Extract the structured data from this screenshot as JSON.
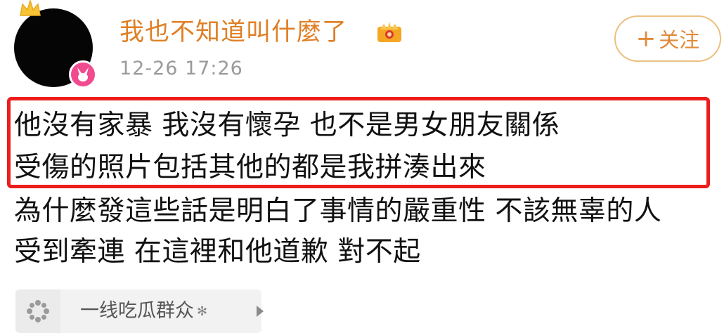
{
  "post": {
    "username": "我也不知道叫什麼了",
    "timestamp": "12-26 17:26",
    "follow_label": "关注",
    "highlighted_lines": [
      "他沒有家暴 我沒有懷孕 也不是男女朋友關係",
      "受傷的照片包括其他的都是我拼湊出來"
    ],
    "body_lines": [
      "為什麼發這些話是明白了事情的嚴重性 不該無辜的人",
      "受到牽連 在這裡和他道歉 對不起"
    ]
  },
  "topic": {
    "label": "一线吃瓜群众",
    "suffix_symbol": "✻"
  },
  "icons": {
    "avatar_crown": "crown-icon",
    "avatar_badge": "bunny-badge-icon",
    "vip": "vip-crown-icon",
    "topic": "flower-icon",
    "topic_arrow": "play-arrow-icon"
  },
  "colors": {
    "username": "#e07f26",
    "follow_border": "#ecc080",
    "highlight_border": "#ee1d1d",
    "badge": "#f04b8f"
  }
}
